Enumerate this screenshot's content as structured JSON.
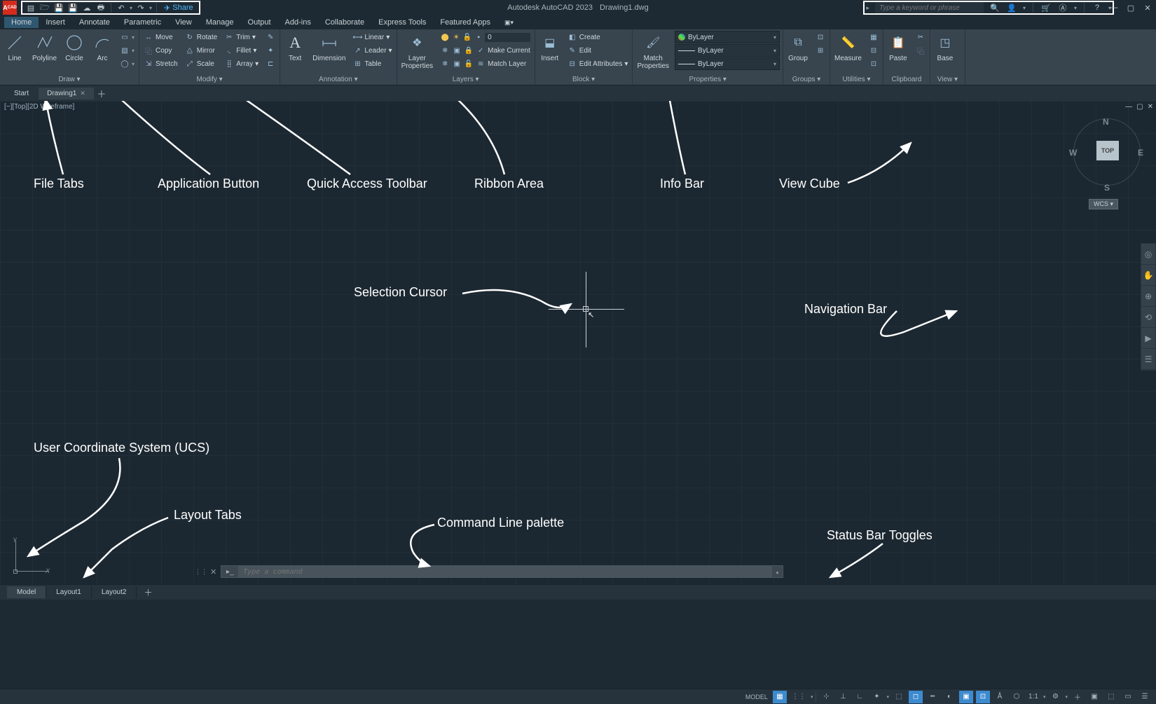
{
  "title": {
    "app": "Autodesk AutoCAD 2023",
    "file": "Drawing1.dwg"
  },
  "app_button": "A",
  "qat": {
    "share": "Share"
  },
  "search": {
    "placeholder": "Type a keyword or phrase"
  },
  "menu": [
    "Home",
    "Insert",
    "Annotate",
    "Parametric",
    "View",
    "Manage",
    "Output",
    "Add-ins",
    "Collaborate",
    "Express Tools",
    "Featured Apps"
  ],
  "ribbon": {
    "draw": {
      "title": "Draw",
      "line": "Line",
      "polyline": "Polyline",
      "circle": "Circle",
      "arc": "Arc"
    },
    "modify": {
      "title": "Modify",
      "move": "Move",
      "rotate": "Rotate",
      "trim": "Trim",
      "copy": "Copy",
      "mirror": "Mirror",
      "fillet": "Fillet",
      "stretch": "Stretch",
      "scale": "Scale",
      "array": "Array"
    },
    "annotation": {
      "title": "Annotation",
      "text": "Text",
      "dimension": "Dimension",
      "linear": "Linear",
      "leader": "Leader",
      "table": "Table"
    },
    "layers": {
      "title": "Layers",
      "props": "Layer\nProperties",
      "current_val": "0",
      "make_current": "Make Current",
      "match_layer": "Match Layer"
    },
    "block": {
      "title": "Block",
      "insert": "Insert",
      "create": "Create",
      "edit": "Edit",
      "edit_attr": "Edit Attributes"
    },
    "properties": {
      "title": "Properties",
      "match": "Match\nProperties",
      "bylayer": "ByLayer"
    },
    "groups": {
      "title": "Groups",
      "group": "Group"
    },
    "utilities": {
      "title": "Utilities",
      "measure": "Measure"
    },
    "clipboard": {
      "title": "Clipboard",
      "paste": "Paste"
    },
    "view": {
      "title": "View",
      "base": "Base"
    }
  },
  "filetabs": {
    "start": "Start",
    "drawing1": "Drawing1"
  },
  "viewport": {
    "label": "[−][Top][2D Wireframe]"
  },
  "viewcube": {
    "top": "TOP",
    "n": "N",
    "s": "S",
    "e": "E",
    "w": "W",
    "wcs": "WCS"
  },
  "cmd": {
    "placeholder": "Type a command"
  },
  "layouts": {
    "model": "Model",
    "l1": "Layout1",
    "l2": "Layout2"
  },
  "status": {
    "model": "MODEL",
    "scale": "1:1"
  },
  "anno": {
    "file_tabs": "File Tabs",
    "app_button": "Application Button",
    "qat": "Quick Access Toolbar",
    "ribbon": "Ribbon Area",
    "info_bar": "Info Bar",
    "view_cube": "View Cube",
    "sel_cursor": "Selection Cursor",
    "nav_bar": "Navigation Bar",
    "ucs": "User Coordinate System (UCS)",
    "layout_tabs": "Layout Tabs",
    "cmd_line": "Command Line palette",
    "status_toggles": "Status Bar Toggles"
  }
}
